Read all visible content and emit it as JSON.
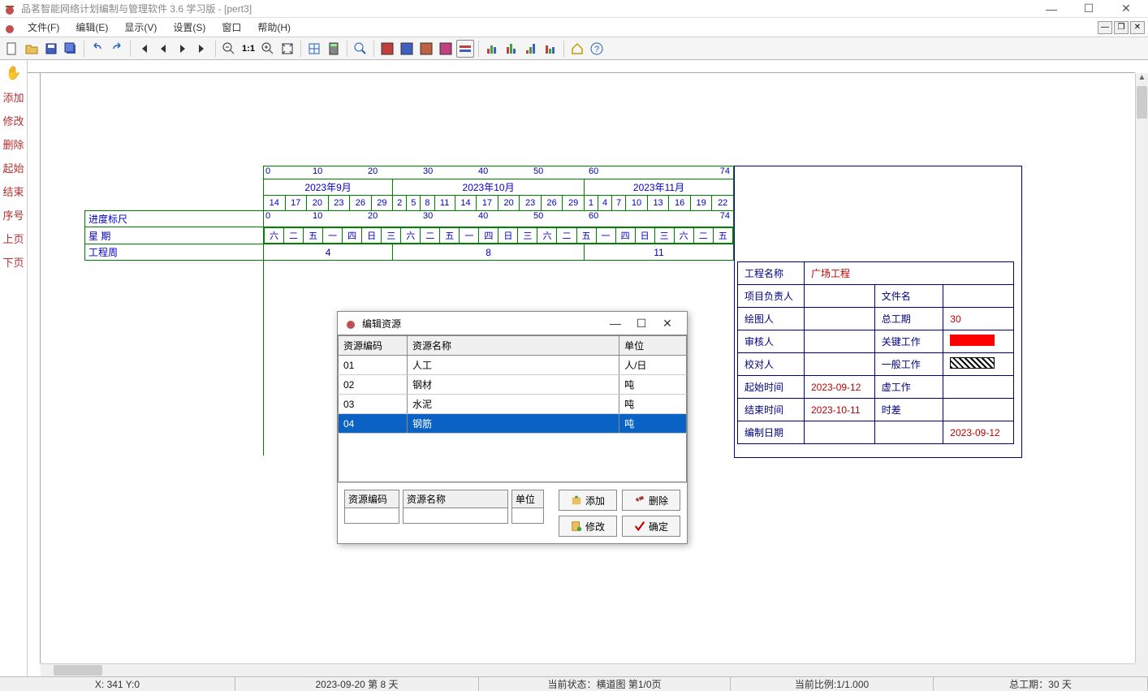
{
  "title": "品茗智能网络计划编制与管理软件 3.6 学习版 - [pert3]",
  "menu": {
    "file": "文件(F)",
    "edit": "编辑(E)",
    "view": "显示(V)",
    "settings": "设置(S)",
    "window": "窗口",
    "help": "帮助(H)"
  },
  "sidebar": {
    "add": "添加",
    "modify": "修改",
    "delete": "删除",
    "start": "起始",
    "end": "结束",
    "seq": "序号",
    "prev": "上页",
    "next": "下页"
  },
  "timeline": {
    "ruler_numbers": [
      "0",
      "10",
      "20",
      "30",
      "40",
      "50",
      "60",
      "74"
    ],
    "months": [
      "2023年9月",
      "2023年10月",
      "2023年11月"
    ],
    "days": [
      "14",
      "17",
      "20",
      "23",
      "26",
      "29",
      "2",
      "5",
      "8",
      "11",
      "14",
      "17",
      "20",
      "23",
      "26",
      "29",
      "1",
      "4",
      "7",
      "10",
      "13",
      "16",
      "19",
      "22"
    ],
    "progress_label": "进度标尺",
    "progress_numbers": [
      "0",
      "10",
      "20",
      "30",
      "40",
      "50",
      "60",
      "74"
    ],
    "week_label": "星  期",
    "weekdays": [
      "六",
      "二",
      "五",
      "一",
      "四",
      "日",
      "三",
      "六",
      "二",
      "五",
      "一",
      "四",
      "日",
      "三",
      "六",
      "二",
      "五",
      "一",
      "四",
      "日",
      "三",
      "六",
      "二",
      "五"
    ],
    "engweek_label": "工程周",
    "engweeks": [
      "4",
      "8",
      "11"
    ]
  },
  "info": {
    "project_name_lbl": "工程名称",
    "project_name": "广场工程",
    "owner_lbl": "项目负责人",
    "owner": "",
    "filename_lbl": "文件名",
    "filename": "",
    "drawer_lbl": "绘图人",
    "drawer": "",
    "duration_lbl": "总工期",
    "duration": "30",
    "reviewer_lbl": "审核人",
    "reviewer": "",
    "critical_lbl": "关键工作",
    "checker_lbl": "校对人",
    "checker": "",
    "normal_lbl": "一般工作",
    "start_lbl": "起始时间",
    "start": "2023-09-12",
    "virtual_lbl": "虚工作",
    "end_lbl": "结束时间",
    "end": "2023-10-11",
    "slack_lbl": "时差",
    "make_date_lbl": "编制日期",
    "make_date": "",
    "make_date2": "2023-09-12"
  },
  "dialog": {
    "title": "编辑资源",
    "col_code": "资源编码",
    "col_name": "资源名称",
    "col_unit": "单位",
    "rows": [
      {
        "code": "01",
        "name": "人工",
        "unit": "人/日"
      },
      {
        "code": "02",
        "name": "钢材",
        "unit": "吨"
      },
      {
        "code": "03",
        "name": "水泥",
        "unit": "吨"
      },
      {
        "code": "04",
        "name": "钢筋",
        "unit": "吨"
      }
    ],
    "form_code_lbl": "资源编码",
    "form_name_lbl": "资源名称",
    "form_unit_lbl": "单位",
    "btn_add": "添加",
    "btn_delete": "删除",
    "btn_modify": "修改",
    "btn_ok": "确定"
  },
  "status": {
    "coords": "X: 341  Y:0",
    "date": "2023-09-20 第 8 天",
    "mode": "当前状态：横道图 第1/0页",
    "zoom": "当前比例:1/1.000",
    "total": "总工期：30 天"
  }
}
